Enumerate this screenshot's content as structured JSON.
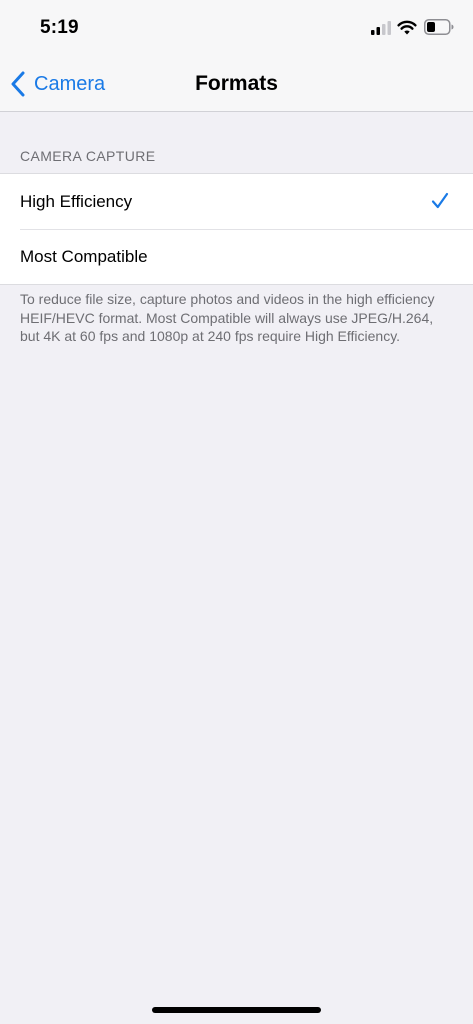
{
  "status_bar": {
    "time": "5:19",
    "icons": [
      "signal-icon",
      "wifi-icon",
      "battery-icon"
    ]
  },
  "nav": {
    "back_label": "Camera",
    "title": "Formats",
    "accent_color": "#1a7ae6"
  },
  "section": {
    "header": "CAMERA CAPTURE",
    "options": [
      {
        "label": "High Efficiency",
        "selected": true
      },
      {
        "label": "Most Compatible",
        "selected": false
      }
    ],
    "footer": "To reduce file size, capture photos and videos in the high efficiency HEIF/HEVC format. Most Compatible will always use JPEG/H.264, but 4K at 60 fps and 1080p at 240 fps require High Efficiency."
  }
}
